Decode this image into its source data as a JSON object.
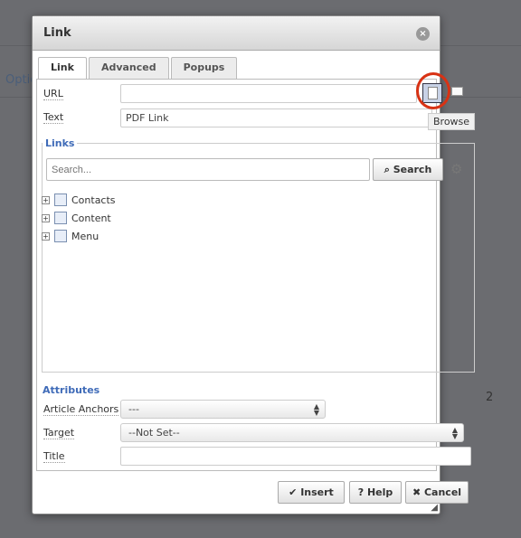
{
  "background": {
    "options_label": "Optio",
    "counter": "2"
  },
  "dialog": {
    "title": "Link",
    "close": "×"
  },
  "tabs": [
    {
      "label": "Link",
      "active": true
    },
    {
      "label": "Advanced"
    },
    {
      "label": "Popups"
    }
  ],
  "fields": {
    "url_label": "URL",
    "url_value": "",
    "text_label": "Text",
    "text_value": "PDF Link"
  },
  "browse_tooltip": "Browse",
  "links": {
    "legend": "Links",
    "search_placeholder": "Search...",
    "search_button": "Search",
    "tree": [
      {
        "label": "Contacts",
        "icon": "contacts-icon"
      },
      {
        "label": "Content",
        "icon": "content-icon"
      },
      {
        "label": "Menu",
        "icon": "menu-icon"
      }
    ]
  },
  "attributes": {
    "legend": "Attributes",
    "anchors_label": "Article Anchors",
    "anchors_value": "---",
    "target_label": "Target",
    "target_value": "--Not Set--",
    "title_label": "Title",
    "title_value": ""
  },
  "buttons": {
    "insert": "Insert",
    "help": "Help",
    "cancel": "Cancel"
  },
  "colors": {
    "accent": "#3f6bb8",
    "highlight_circle": "#d83214"
  }
}
